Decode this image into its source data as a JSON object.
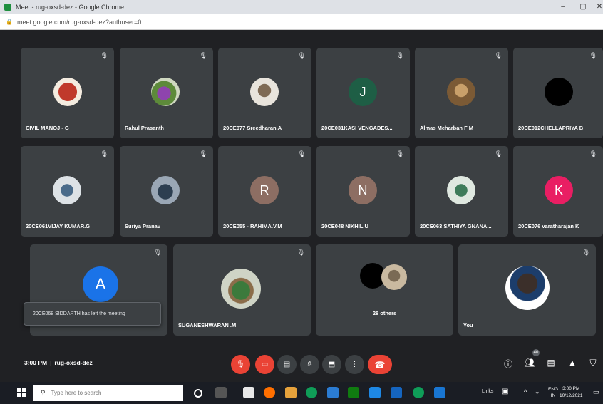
{
  "browser": {
    "window_title": "Meet - rug-oxsd-dez - Google Chrome",
    "url": "meet.google.com/rug-oxsd-dez?authuser=0",
    "min_label": "–",
    "max_label": "▢",
    "close_label": "✕"
  },
  "participants": [
    {
      "name": "CIVIL MANOJ - G",
      "avatar_type": "photo",
      "photo_colors": [
        "#f4ece0",
        "#c0392b"
      ]
    },
    {
      "name": "Rahul Prasanth",
      "avatar_type": "photo",
      "photo_colors": [
        "#cfd8c0",
        "#8e44ad"
      ]
    },
    {
      "name": "20CE077 Sreedharan.A",
      "avatar_type": "photo",
      "photo_colors": [
        "#e8e4dc",
        "#7f6b55"
      ]
    },
    {
      "name": "20CE031KASI VENGADES...",
      "avatar_type": "letter",
      "letter": "J",
      "color": "#1e5e45"
    },
    {
      "name": "Almas Meharban F M",
      "avatar_type": "photo",
      "photo_colors": [
        "#7b5a35",
        "#c9a06a"
      ]
    },
    {
      "name": "20CE012CHELLAPRIYA B",
      "avatar_type": "photo",
      "photo_colors": [
        "#000000",
        "#111111"
      ]
    },
    {
      "name": "20CE061VIJAY KUMAR.G",
      "avatar_type": "photo",
      "photo_colors": [
        "#dde2e6",
        "#4a6b8a"
      ]
    },
    {
      "name": "Suriya Pranav",
      "avatar_type": "photo",
      "photo_colors": [
        "#9aa7b5",
        "#2c3e50"
      ]
    },
    {
      "name": "20CE055 - RAHIMA.V.M",
      "avatar_type": "letter",
      "letter": "R",
      "color": "#8d6e63"
    },
    {
      "name": "20CE048 NIKHIL.U",
      "avatar_type": "letter",
      "letter": "N",
      "color": "#8d6e63"
    },
    {
      "name": "20CE063 SATHIYA GNANA...",
      "avatar_type": "photo",
      "photo_colors": [
        "#dfe8e0",
        "#3e7b5a"
      ]
    },
    {
      "name": "20CE076 varatharajan K",
      "avatar_type": "letter",
      "letter": "K",
      "color": "#e91e63"
    },
    {
      "name": "",
      "avatar_type": "letter",
      "letter": "A",
      "color": "#1a73e8"
    },
    {
      "name": "SUGANESHWARAN .M",
      "avatar_type": "photo",
      "photo_colors": [
        "#cfd4c6",
        "#3c7a3c"
      ]
    },
    {
      "name": "28 others",
      "avatar_type": "group",
      "photo_colors": [
        "#000000",
        "#c9b9a0"
      ]
    },
    {
      "name": "You",
      "avatar_type": "photo",
      "photo_colors": [
        "#ffffff",
        "#3b2f2a"
      ]
    }
  ],
  "toast": {
    "text": "20CE068 SIDDARTH has left the meeting"
  },
  "meeting": {
    "time": "3:00 PM",
    "code": "rug-oxsd-dez"
  },
  "controls": {
    "mic_icon": "mic-off-icon",
    "camera_icon": "camera-off-icon",
    "captions_icon": "captions-icon",
    "raise_hand_icon": "raise-hand-icon",
    "present_icon": "present-icon",
    "more_icon": "more-options-icon",
    "end_call_icon": "end-call-icon",
    "people_count": "40"
  },
  "taskbar": {
    "search_placeholder": "Type here to search",
    "tray_lang": "ENG",
    "tray_region": "IN",
    "tray_links": "Links",
    "clock_time": "3:00 PM",
    "clock_date": "10/12/2021"
  },
  "colors": {
    "mic_red": "#ea4335",
    "tile_bg": "#3c4043",
    "stage_bg": "#202124"
  }
}
